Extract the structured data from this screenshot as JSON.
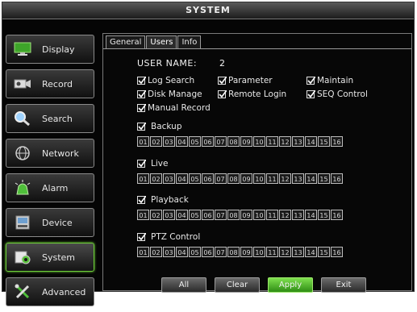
{
  "window": {
    "title": "SYSTEM"
  },
  "sidebar": {
    "items": [
      {
        "label": "Display",
        "icon": "monitor-icon",
        "active": false
      },
      {
        "label": "Record",
        "icon": "camera-icon",
        "active": false
      },
      {
        "label": "Search",
        "icon": "magnifier-icon",
        "active": false
      },
      {
        "label": "Network",
        "icon": "globe-icon",
        "active": false
      },
      {
        "label": "Alarm",
        "icon": "siren-icon",
        "active": false
      },
      {
        "label": "Device",
        "icon": "hdd-icon",
        "active": false
      },
      {
        "label": "System",
        "icon": "system-gear-icon",
        "active": true
      },
      {
        "label": "Advanced",
        "icon": "tools-icon",
        "active": false
      }
    ]
  },
  "tabs": [
    {
      "label": "General",
      "active": false
    },
    {
      "label": "Users",
      "active": true
    },
    {
      "label": "Info",
      "active": false
    }
  ],
  "user": {
    "name_label": "USER NAME:",
    "name_value": "2"
  },
  "permissions": {
    "log_search": {
      "label": "Log Search",
      "checked": true
    },
    "parameter": {
      "label": "Parameter",
      "checked": true
    },
    "maintain": {
      "label": "Maintain",
      "checked": true
    },
    "disk_manage": {
      "label": "Disk Manage",
      "checked": true
    },
    "remote_login": {
      "label": "Remote Login",
      "checked": true
    },
    "seq_control": {
      "label": "SEQ Control",
      "checked": true
    },
    "manual_record": {
      "label": "Manual Record",
      "checked": true
    }
  },
  "channel_groups": {
    "backup": {
      "label": "Backup",
      "checked": true
    },
    "live": {
      "label": "Live",
      "checked": true
    },
    "playback": {
      "label": "Playback",
      "checked": true
    },
    "ptz": {
      "label": "PTZ Control",
      "checked": true
    }
  },
  "channels": [
    "01",
    "02",
    "03",
    "04",
    "05",
    "06",
    "07",
    "08",
    "09",
    "10",
    "11",
    "12",
    "13",
    "14",
    "15",
    "16"
  ],
  "buttons": {
    "all": "All",
    "clear": "Clear",
    "apply": "Apply",
    "exit": "Exit"
  },
  "colors": {
    "accent_green": "#6fd03a",
    "apply_green": "#4cb826",
    "background": "#050505"
  }
}
